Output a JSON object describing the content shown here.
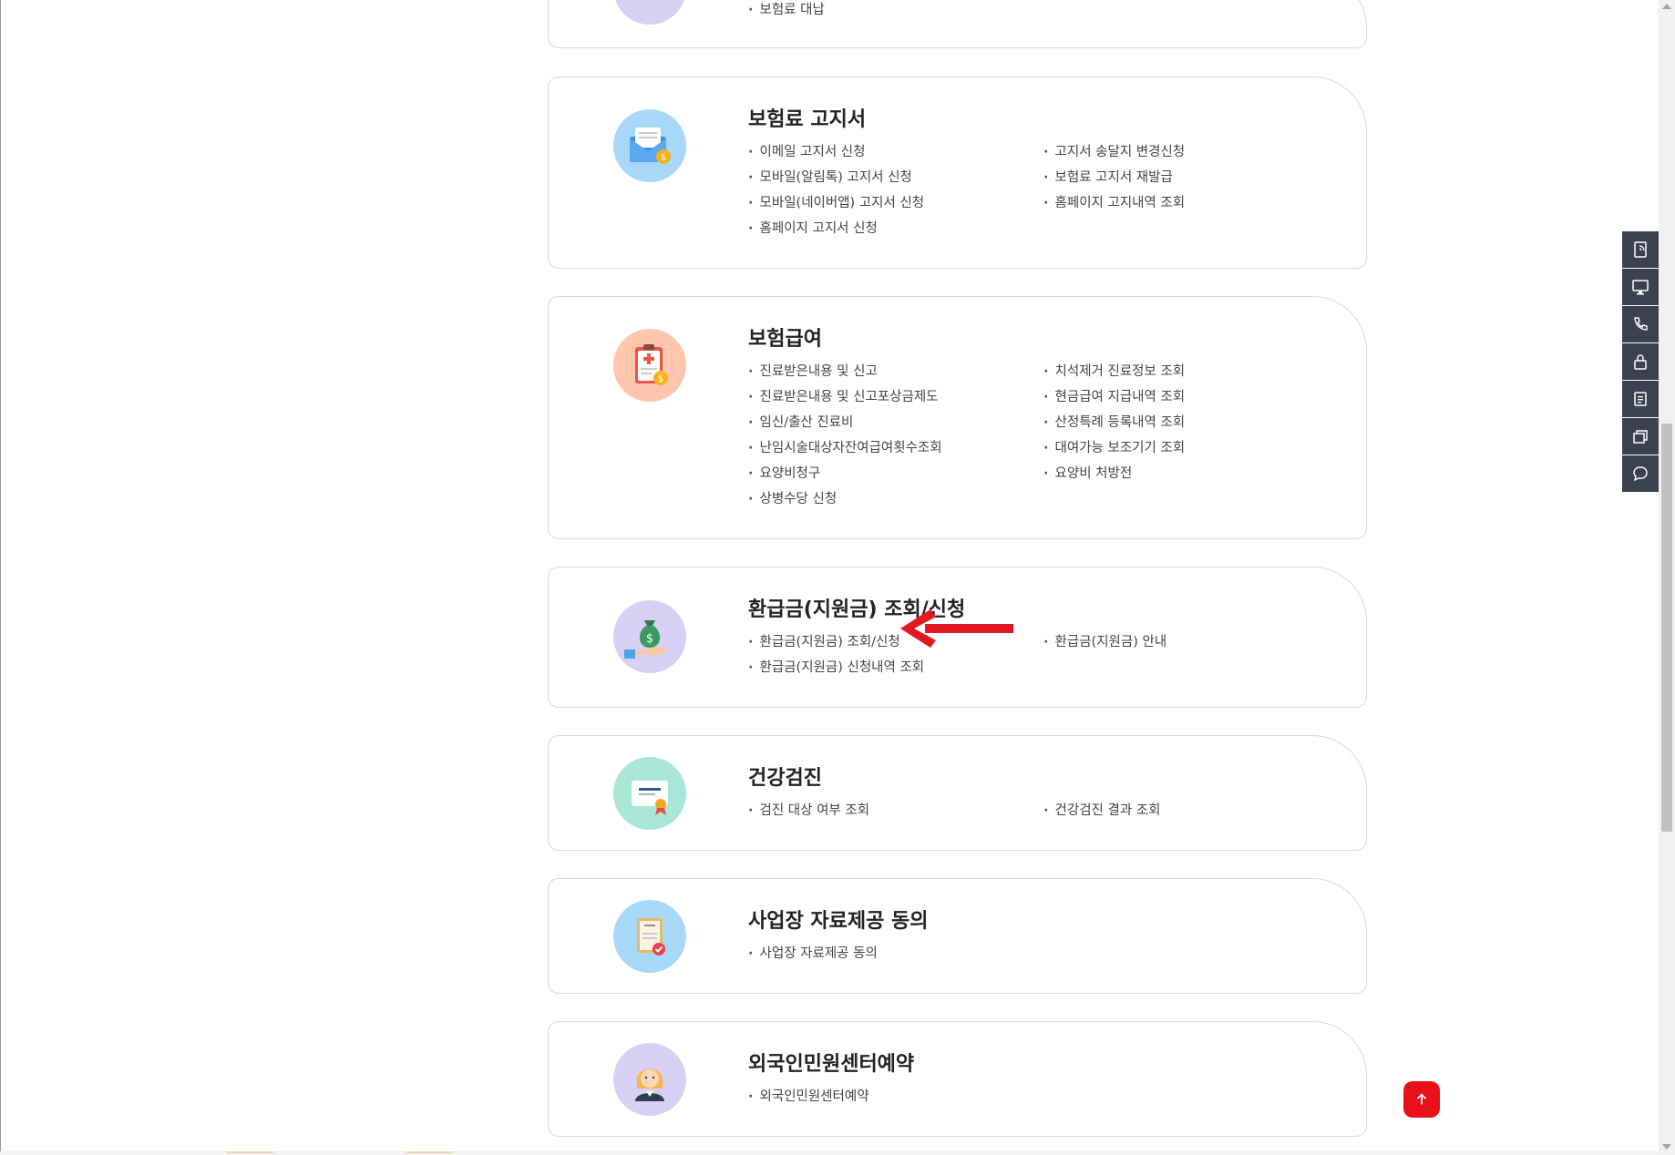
{
  "cards": [
    {
      "title": "",
      "col1": [
        "보험료 대납"
      ],
      "col2": []
    },
    {
      "title": "보험료 고지서",
      "icon": "envelope-coin-icon",
      "icon_bg": "#a8d8f8",
      "col1": [
        "이메일 고지서 신청",
        "모바일(알림톡) 고지서 신청",
        "모바일(네이버앱) 고지서 신청",
        "홈페이지 고지서 신청"
      ],
      "col2": [
        "고지서 송달지 변경신청",
        "보험료 고지서 재발급",
        "홈페이지 고지내역 조회"
      ]
    },
    {
      "title": "보험급여",
      "icon": "medical-clipboard-icon",
      "icon_bg": "#ffc5ad",
      "col1": [
        "진료받은내용 및 신고",
        "진료받은내용 및 신고포상금제도",
        "임신/출산 진료비",
        "난임시술대상자잔여급여횟수조회",
        "요양비청구",
        "상병수당 신청"
      ],
      "col2": [
        "치석제거 진료정보 조회",
        "현금급여 지급내역 조회",
        "산정특례 등록내역 조회",
        "대여가능 보조기기 조회",
        "요양비 처방전"
      ]
    },
    {
      "title": "환급금(지원금) 조회/신청",
      "icon": "money-bag-hand-icon",
      "icon_bg": "#d8cff5",
      "col1": [
        "환급금(지원금) 조회/신청",
        "환급금(지원금) 신청내역 조회"
      ],
      "col2": [
        "환급금(지원금) 안내"
      ]
    },
    {
      "title": "건강검진",
      "icon": "certificate-icon",
      "icon_bg": "#a9e6d5",
      "col1": [
        "검진 대상 여부 조회"
      ],
      "col2": [
        "건강검진 결과 조회"
      ]
    },
    {
      "title": "사업장 자료제공 동의",
      "icon": "document-check-icon",
      "icon_bg": "#a8d8f8",
      "col1": [
        "사업장 자료제공 동의"
      ],
      "col2": []
    },
    {
      "title": "외국인민원센터예약",
      "icon": "person-avatar-icon",
      "icon_bg": "#d8cff5",
      "col1": [
        "외국인민원센터예약"
      ],
      "col2": []
    }
  ],
  "quick_menu": [
    "document-icon",
    "monitor-icon",
    "phone-icon",
    "lock-icon",
    "list-icon",
    "windows-icon",
    "chat-icon"
  ],
  "colors": {
    "accent_red": "#e8101a",
    "quick_menu_bg": "#3b4150",
    "border": "#d9d9d9"
  }
}
